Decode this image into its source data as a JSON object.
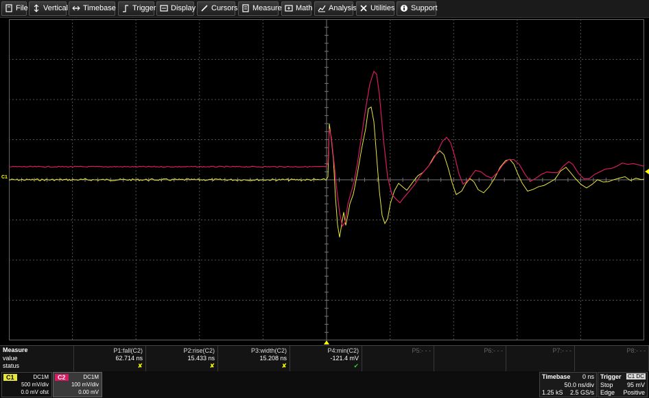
{
  "menu": [
    {
      "label": "File",
      "icon": "file-icon"
    },
    {
      "label": "Vertical",
      "icon": "vertical-icon"
    },
    {
      "label": "Timebase",
      "icon": "timebase-icon"
    },
    {
      "label": "Trigger",
      "icon": "trigger-icon"
    },
    {
      "label": "Display",
      "icon": "display-icon"
    },
    {
      "label": "Cursors",
      "icon": "cursors-icon"
    },
    {
      "label": "Measure",
      "icon": "measure-icon"
    },
    {
      "label": "Math",
      "icon": "math-icon"
    },
    {
      "label": "Analysis",
      "icon": "analysis-icon"
    },
    {
      "label": "Utilities",
      "icon": "utilities-icon"
    },
    {
      "label": "Support",
      "icon": "support-icon"
    }
  ],
  "traces": {
    "c1_color": "#e8e83a",
    "c2_color": "#d81b60",
    "c1_marker": "C1"
  },
  "measure": {
    "title": "Measure",
    "row_value": "value",
    "row_status": "status",
    "params": [
      {
        "name": "P1:fall(C2)",
        "value": "62.714 ns",
        "status": "x"
      },
      {
        "name": "P2:rise(C2)",
        "value": "15.433 ns",
        "status": "x"
      },
      {
        "name": "P3:width(C2)",
        "value": "15.208 ns",
        "status": "x"
      },
      {
        "name": "P4:min(C2)",
        "value": "-121.4 mV",
        "status": "check"
      },
      {
        "name": "P5:- - -",
        "value": "",
        "status": ""
      },
      {
        "name": "P6:- - -",
        "value": "",
        "status": ""
      },
      {
        "name": "P7:- - -",
        "value": "",
        "status": ""
      },
      {
        "name": "P8:- - -",
        "value": "",
        "status": ""
      }
    ]
  },
  "channels": {
    "c1": {
      "tag": "C1",
      "coupling": "DC1M",
      "vdiv": "500 mV/div",
      "offset": "0.0 mV ofst"
    },
    "c2": {
      "tag": "C2",
      "coupling": "DC1M",
      "vdiv": "100 mV/div",
      "offset": "0.00 mV"
    }
  },
  "timebase": {
    "title": "Timebase",
    "delay": "0 ns",
    "tdiv": "50.0 ns/div",
    "samples": "1.25 kS",
    "rate": "2.5 GS/s"
  },
  "trigger": {
    "title": "Trigger",
    "source": "C1 DC",
    "mode": "Stop",
    "level": "95 mV",
    "type": "Edge",
    "slope": "Positive"
  }
}
